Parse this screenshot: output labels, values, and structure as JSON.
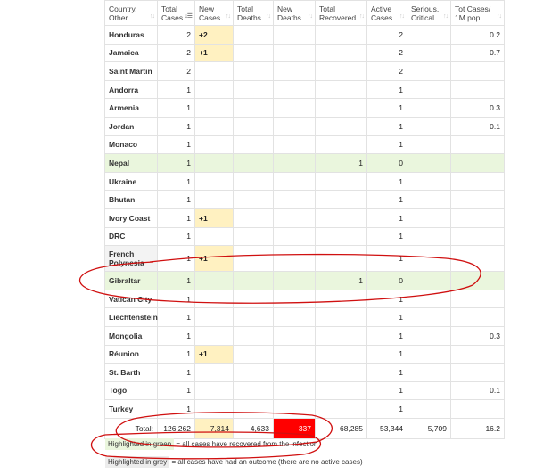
{
  "headers": [
    {
      "label": "Country, Other"
    },
    {
      "label": "Total Cases"
    },
    {
      "label": "New Cases"
    },
    {
      "label": "Total Deaths"
    },
    {
      "label": "New Deaths"
    },
    {
      "label": "Total Recovered"
    },
    {
      "label": "Active Cases"
    },
    {
      "label": "Serious, Critical"
    },
    {
      "label": "Tot Cases/ 1M pop"
    }
  ],
  "rows": [
    {
      "country": "Honduras",
      "total_cases": "2",
      "new_cases": "+2",
      "total_deaths": "",
      "new_deaths": "",
      "total_recovered": "",
      "active_cases": "2",
      "serious": "",
      "per_million": "0.2",
      "highlight": "none"
    },
    {
      "country": "Jamaica",
      "total_cases": "2",
      "new_cases": "+1",
      "total_deaths": "",
      "new_deaths": "",
      "total_recovered": "",
      "active_cases": "2",
      "serious": "",
      "per_million": "0.7",
      "highlight": "none"
    },
    {
      "country": "Saint Martin",
      "total_cases": "2",
      "new_cases": "",
      "total_deaths": "",
      "new_deaths": "",
      "total_recovered": "",
      "active_cases": "2",
      "serious": "",
      "per_million": "",
      "highlight": "none"
    },
    {
      "country": "Andorra",
      "total_cases": "1",
      "new_cases": "",
      "total_deaths": "",
      "new_deaths": "",
      "total_recovered": "",
      "active_cases": "1",
      "serious": "",
      "per_million": "",
      "highlight": "none"
    },
    {
      "country": "Armenia",
      "total_cases": "1",
      "new_cases": "",
      "total_deaths": "",
      "new_deaths": "",
      "total_recovered": "",
      "active_cases": "1",
      "serious": "",
      "per_million": "0.3",
      "highlight": "none"
    },
    {
      "country": "Jordan",
      "total_cases": "1",
      "new_cases": "",
      "total_deaths": "",
      "new_deaths": "",
      "total_recovered": "",
      "active_cases": "1",
      "serious": "",
      "per_million": "0.1",
      "highlight": "none"
    },
    {
      "country": "Monaco",
      "total_cases": "1",
      "new_cases": "",
      "total_deaths": "",
      "new_deaths": "",
      "total_recovered": "",
      "active_cases": "1",
      "serious": "",
      "per_million": "",
      "highlight": "none"
    },
    {
      "country": "Nepal",
      "total_cases": "1",
      "new_cases": "",
      "total_deaths": "",
      "new_deaths": "",
      "total_recovered": "1",
      "active_cases": "0",
      "serious": "",
      "per_million": "",
      "highlight": "green"
    },
    {
      "country": "Ukraine",
      "total_cases": "1",
      "new_cases": "",
      "total_deaths": "",
      "new_deaths": "",
      "total_recovered": "",
      "active_cases": "1",
      "serious": "",
      "per_million": "",
      "highlight": "none"
    },
    {
      "country": "Bhutan",
      "total_cases": "1",
      "new_cases": "",
      "total_deaths": "",
      "new_deaths": "",
      "total_recovered": "",
      "active_cases": "1",
      "serious": "",
      "per_million": "",
      "highlight": "none"
    },
    {
      "country": "Ivory Coast",
      "total_cases": "1",
      "new_cases": "+1",
      "total_deaths": "",
      "new_deaths": "",
      "total_recovered": "",
      "active_cases": "1",
      "serious": "",
      "per_million": "",
      "highlight": "none"
    },
    {
      "country": "DRC",
      "total_cases": "1",
      "new_cases": "",
      "total_deaths": "",
      "new_deaths": "",
      "total_recovered": "",
      "active_cases": "1",
      "serious": "",
      "per_million": "",
      "highlight": "none"
    },
    {
      "country": "French Polynesia",
      "total_cases": "1",
      "new_cases": "+1",
      "total_deaths": "",
      "new_deaths": "",
      "total_recovered": "",
      "active_cases": "1",
      "serious": "",
      "per_million": "",
      "highlight": "grey",
      "tall": true
    },
    {
      "country": "Gibraltar",
      "total_cases": "1",
      "new_cases": "",
      "total_deaths": "",
      "new_deaths": "",
      "total_recovered": "1",
      "active_cases": "0",
      "serious": "",
      "per_million": "",
      "highlight": "green"
    },
    {
      "country": "Vatican City",
      "total_cases": "1",
      "new_cases": "",
      "total_deaths": "",
      "new_deaths": "",
      "total_recovered": "",
      "active_cases": "1",
      "serious": "",
      "per_million": "",
      "highlight": "none"
    },
    {
      "country": "Liechtenstein",
      "total_cases": "1",
      "new_cases": "",
      "total_deaths": "",
      "new_deaths": "",
      "total_recovered": "",
      "active_cases": "1",
      "serious": "",
      "per_million": "",
      "highlight": "none"
    },
    {
      "country": "Mongolia",
      "total_cases": "1",
      "new_cases": "",
      "total_deaths": "",
      "new_deaths": "",
      "total_recovered": "",
      "active_cases": "1",
      "serious": "",
      "per_million": "0.3",
      "highlight": "none"
    },
    {
      "country": "Réunion",
      "total_cases": "1",
      "new_cases": "+1",
      "total_deaths": "",
      "new_deaths": "",
      "total_recovered": "",
      "active_cases": "1",
      "serious": "",
      "per_million": "",
      "highlight": "none"
    },
    {
      "country": "St. Barth",
      "total_cases": "1",
      "new_cases": "",
      "total_deaths": "",
      "new_deaths": "",
      "total_recovered": "",
      "active_cases": "1",
      "serious": "",
      "per_million": "",
      "highlight": "none"
    },
    {
      "country": "Togo",
      "total_cases": "1",
      "new_cases": "",
      "total_deaths": "",
      "new_deaths": "",
      "total_recovered": "",
      "active_cases": "1",
      "serious": "",
      "per_million": "0.1",
      "highlight": "none"
    },
    {
      "country": "Turkey",
      "total_cases": "1",
      "new_cases": "",
      "total_deaths": "",
      "new_deaths": "",
      "total_recovered": "",
      "active_cases": "1",
      "serious": "",
      "per_million": "",
      "highlight": "none"
    }
  ],
  "total": {
    "label": "Total:",
    "total_cases": "126,262",
    "new_cases": "7,314",
    "total_deaths": "4,633",
    "new_deaths": "337",
    "total_recovered": "68,285",
    "active_cases": "53,344",
    "serious": "5,709",
    "per_million": "16.2"
  },
  "legend": {
    "green_label": "Highlighted in green",
    "green_text": "= all cases have recovered from the infection",
    "grey_label": "Highlighted in grey",
    "grey_text": "= all cases have had an outcome (there are no active cases)"
  },
  "colors": {
    "green_highlight": "#eaf6dd",
    "new_cases_highlight": "#fff1c1",
    "new_deaths_highlight": "#ff0000",
    "annotation_ink": "#d01010"
  },
  "icons": {
    "sort": "sort-arrows-icon"
  }
}
